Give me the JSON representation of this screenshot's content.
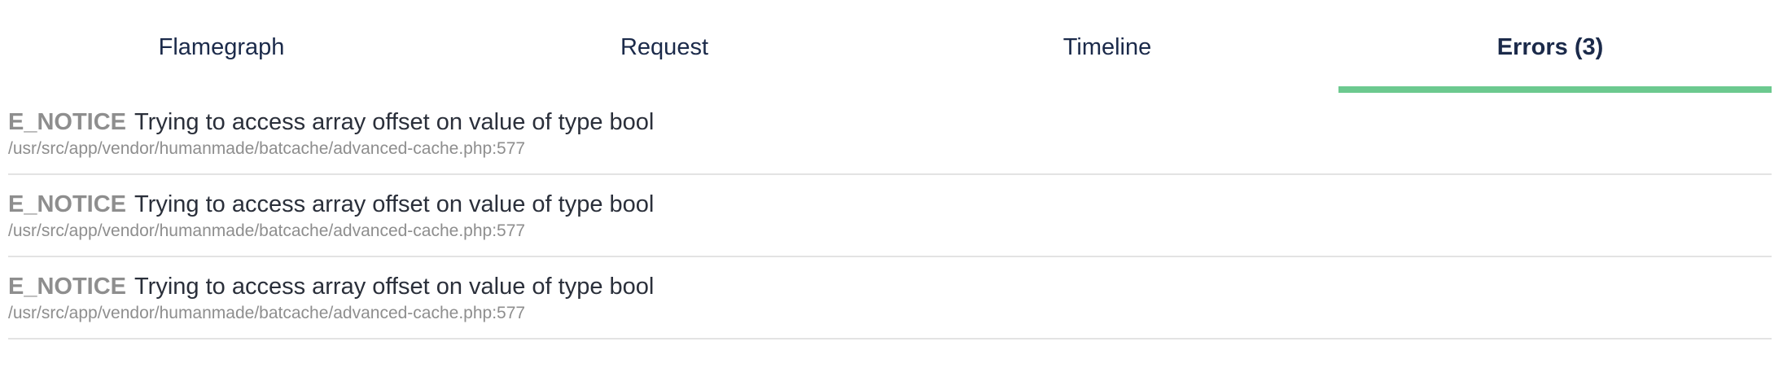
{
  "tabs": [
    {
      "label": "Flamegraph",
      "active": false
    },
    {
      "label": "Request",
      "active": false
    },
    {
      "label": "Timeline",
      "active": false
    },
    {
      "label": "Errors (3)",
      "active": true
    }
  ],
  "errors": [
    {
      "type": "E_NOTICE",
      "message": "Trying to access array offset on value of type bool",
      "location": "/usr/src/app/vendor/humanmade/batcache/advanced-cache.php:577"
    },
    {
      "type": "E_NOTICE",
      "message": "Trying to access array offset on value of type bool",
      "location": "/usr/src/app/vendor/humanmade/batcache/advanced-cache.php:577"
    },
    {
      "type": "E_NOTICE",
      "message": "Trying to access array offset on value of type bool",
      "location": "/usr/src/app/vendor/humanmade/batcache/advanced-cache.php:577"
    }
  ],
  "colors": {
    "active_tab_underline": "#6cc98f",
    "tab_text": "#1b2a4a",
    "error_type_text": "#8e8e8e",
    "path_text": "#8e8e8e",
    "divider": "#e3e3e3"
  }
}
